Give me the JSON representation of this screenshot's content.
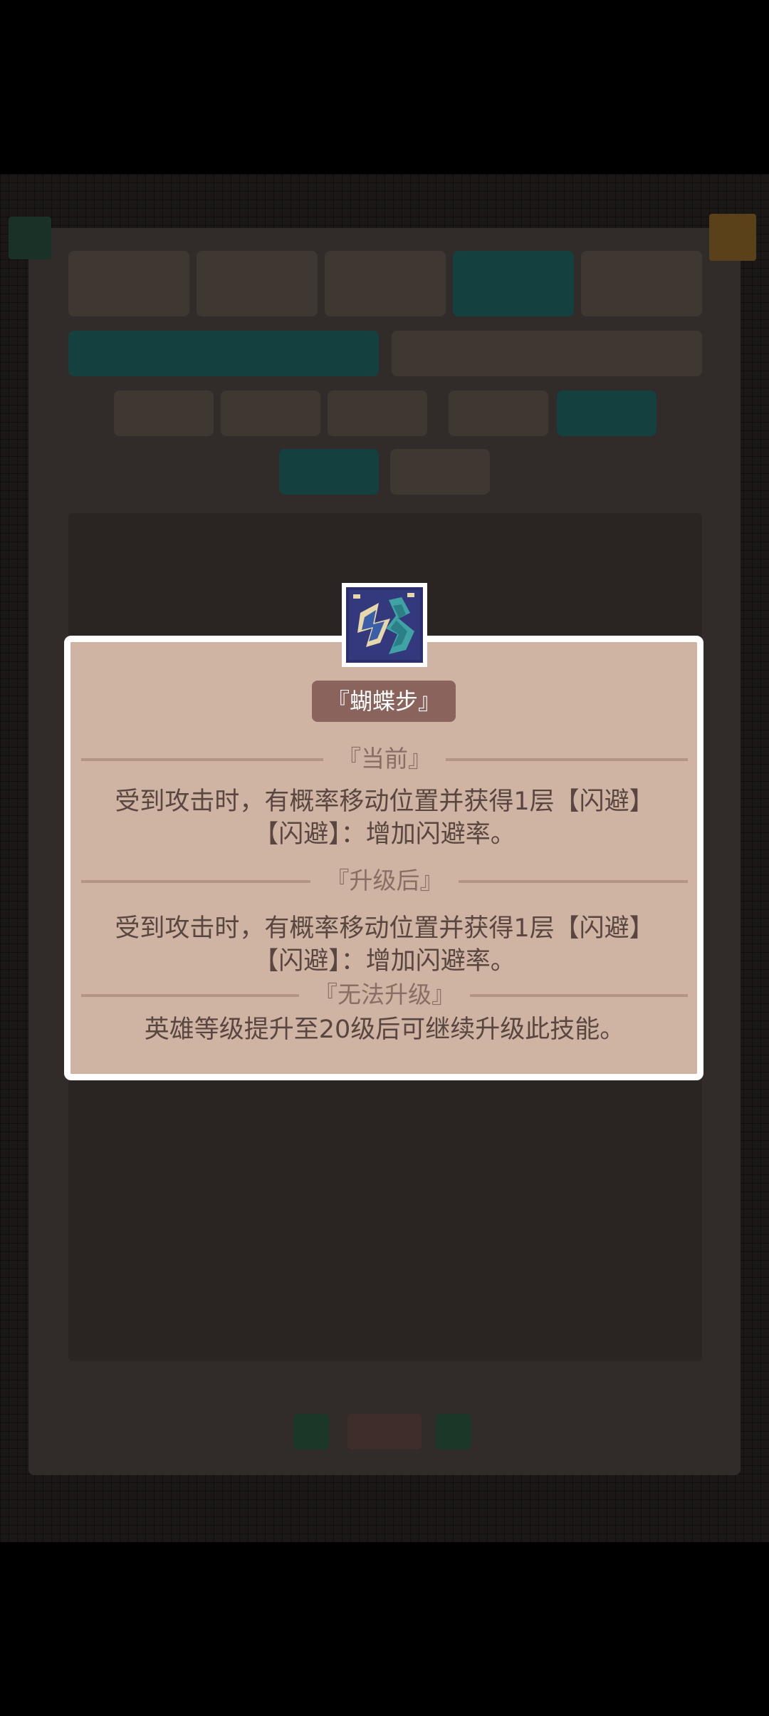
{
  "popup": {
    "skill_name": "『蝴蝶步』",
    "current_header": "『当前』",
    "current_line1": "受到攻击时，有概率移动位置并获得1层【闪避】",
    "current_line2": "【闪避】：增加闪避率。",
    "upgrade_header": "『升级后』",
    "upgrade_line1": "受到攻击时，有概率移动位置并获得1层【闪避】",
    "upgrade_line2": "【闪避】：增加闪避率。",
    "cannot_header": "『无法升级』",
    "cannot_text": "英雄等级提升至20级后可继续升级此技能。",
    "icon": "butterfly-step-skill-icon"
  },
  "colors": {
    "popup_bg": "#cfb4a3",
    "badge_bg": "#8a645c",
    "accent_teal": "#2e8f8c"
  }
}
